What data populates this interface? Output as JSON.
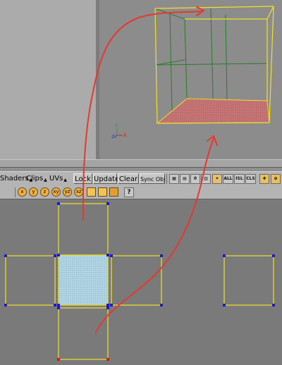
{
  "menu": {
    "shaders": "Shaders",
    "clips": "Clips",
    "uvs": "UVs"
  },
  "buttons": {
    "lock": "Lock",
    "update": "Update",
    "clear": "Clear",
    "sync_obj": "Sync Obj"
  },
  "toolbar_right": {
    "all": "ALL",
    "isl": "ISL",
    "cls": "CLS",
    "help": "?"
  },
  "viewport": {
    "axis_y": "Y",
    "axis_x": "X",
    "axis_z": "Z"
  },
  "colors": {
    "wire_yellow": "#f0e12a",
    "wire_green": "#2a7a2a",
    "selected_face": "#c77a7a",
    "uv_selected_fill": "#a9cfe0",
    "vertex_blue": "#1a1ad0",
    "vertex_red": "#d01a1a",
    "annotation_red": "#e23a30"
  },
  "icons": [
    "x-icon",
    "y-icon",
    "z-icon",
    "xy-icon",
    "yz-icon",
    "xz-icon",
    "select-box-icon",
    "select-fill-icon",
    "grid-icon",
    "help-icon"
  ]
}
